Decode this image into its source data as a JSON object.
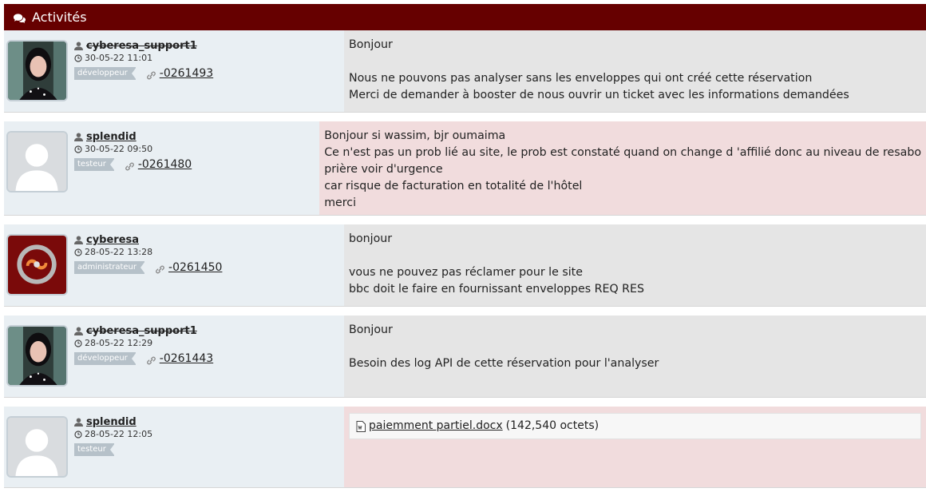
{
  "header": {
    "title": "Activités",
    "icon": "comments-icon",
    "color": "#660000"
  },
  "entries": [
    {
      "user": "cyberesa_support1",
      "date": "30-05-22 11:01",
      "role": "développeur",
      "ref": "-0261493",
      "lines": [
        "Bonjour",
        "",
        "Nous ne pouvons pas analyser sans les enveloppes qui ont créé cette réservation",
        "Merci de demander à booster de nous ouvrir un ticket avec les informations demandées"
      ]
    },
    {
      "user": "splendid",
      "date": "30-05-22 09:50",
      "role": "testeur",
      "ref": "-0261480",
      "lines": [
        "Bonjour si wassim, bjr oumaima",
        "Ce n'est pas un prob lié au site, le prob est constaté quand on change d 'affilié donc au niveau de resabo",
        "prière voir d'urgence",
        "car risque de facturation en totalité de l'hôtel",
        "merci"
      ]
    },
    {
      "user": "cyberesa",
      "date": "28-05-22 13:28",
      "role": "administrateur",
      "ref": "-0261450",
      "lines": [
        "bonjour",
        "",
        "vous ne pouvez pas réclamer pour le site",
        "bbc doit le faire en fournissant enveloppes REQ RES"
      ]
    },
    {
      "user": "cyberesa_support1",
      "date": "28-05-22 12:29",
      "role": "développeur",
      "ref": "-0261443",
      "lines": [
        "Bonjour",
        "",
        "Besoin des log API de cette réservation pour l'analyser"
      ]
    },
    {
      "user": "splendid",
      "date": "28-05-22 12:05",
      "role": "testeur",
      "attachment": {
        "name": "paiemment partiel.docx",
        "size": "(142,540 octets)"
      }
    }
  ]
}
